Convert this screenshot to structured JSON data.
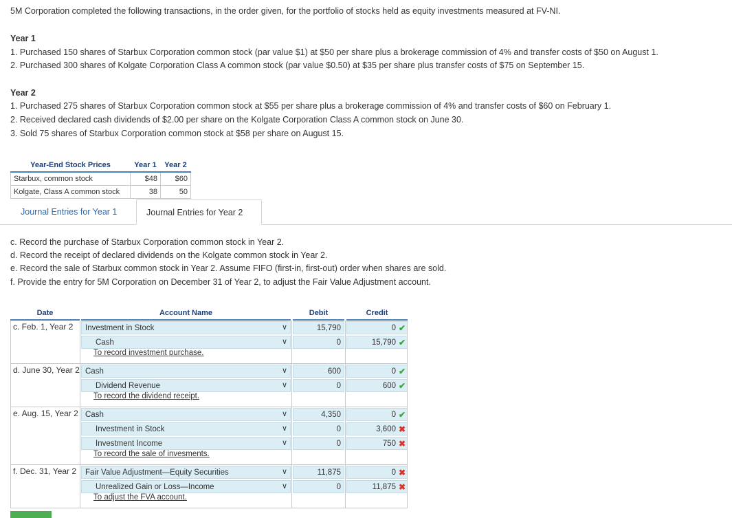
{
  "intro": "5M Corporation completed the following transactions, in the order given, for the portfolio of stocks held as equity investments measured at FV-NI.",
  "year1": {
    "heading": "Year 1",
    "items": [
      "1. Purchased 150 shares of Starbux Corporation common stock (par value $1) at $50 per share plus a brokerage commission of 4% and transfer costs of $50 on August 1.",
      "2. Purchased 300 shares of Kolgate Corporation Class A common stock (par value $0.50) at $35 per share plus transfer costs of $75 on September 15."
    ]
  },
  "year2": {
    "heading": "Year 2",
    "items": [
      "1. Purchased 275 shares of Starbux Corporation common stock at $55 per share plus a brokerage commission of 4% and transfer costs of $60 on February 1.",
      "2. Received declared cash dividends of $2.00 per share on the Kolgate Corporation Class A common stock on June 30.",
      "3. Sold 75 shares of Starbux Corporation common stock at $58 per share on August 15."
    ]
  },
  "prices": {
    "headers": [
      "Year-End Stock Prices",
      "Year 1",
      "Year 2"
    ],
    "rows": [
      [
        "Starbux, common stock",
        "$48",
        "$60"
      ],
      [
        "Kolgate, Class A common stock",
        "38",
        "50"
      ]
    ]
  },
  "tabs": [
    "Journal Entries for Year 1",
    "Journal Entries for Year 2"
  ],
  "requirements": [
    "c. Record the purchase of Starbux Corporation common stock in Year 2.",
    "d. Record the receipt of declared dividends on the Kolgate common stock in Year 2.",
    "e. Record the sale of Starbux common stock in Year 2. Assume FIFO (first-in, first-out) order when shares are sold.",
    "f. Provide the entry for 5M Corporation on December 31 of Year 2, to adjust the Fair Value Adjustment account."
  ],
  "journal": {
    "headers": {
      "date": "Date",
      "account": "Account Name",
      "debit": "Debit",
      "credit": "Credit"
    },
    "caret": "∨",
    "marks": {
      "ok": "✔",
      "bad": "✖"
    },
    "entries": [
      {
        "date": "c. Feb. 1, Year 2",
        "lines": [
          {
            "account": "Investment in Stock",
            "debit": "15,790",
            "credit": "0",
            "status": "ok"
          },
          {
            "account": "Cash",
            "debit": "0",
            "credit": "15,790",
            "status": "ok"
          }
        ],
        "memo": "To record investment purchase."
      },
      {
        "date": "d. June 30, Year 2",
        "lines": [
          {
            "account": "Cash",
            "debit": "600",
            "credit": "0",
            "status": "ok"
          },
          {
            "account": "Dividend Revenue",
            "debit": "0",
            "credit": "600",
            "status": "ok"
          }
        ],
        "memo": "To record the dividend receipt."
      },
      {
        "date": "e. Aug. 15, Year 2",
        "lines": [
          {
            "account": "Cash",
            "debit": "4,350",
            "credit": "0",
            "status": "ok"
          },
          {
            "account": "Investment in Stock",
            "debit": "0",
            "credit": "3,600",
            "status": "bad"
          },
          {
            "account": "Investment Income",
            "debit": "0",
            "credit": "750",
            "status": "bad"
          }
        ],
        "memo": "To record the sale of invesments."
      },
      {
        "date": "f. Dec. 31, Year 2",
        "lines": [
          {
            "account": "Fair Value Adjustment—Equity Securities",
            "debit": "11,875",
            "credit": "0",
            "status": "bad"
          },
          {
            "account": "Unrealized Gain or Loss—Income",
            "debit": "0",
            "credit": "11,875",
            "status": "bad"
          }
        ],
        "memo": "To adjust the FVA account."
      }
    ]
  }
}
